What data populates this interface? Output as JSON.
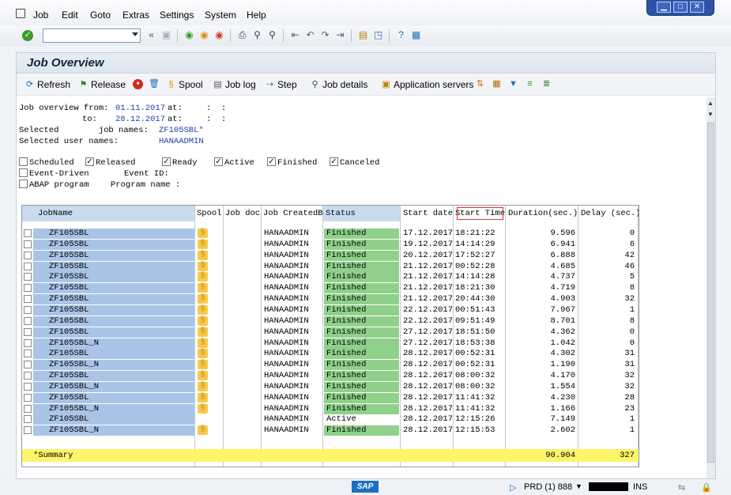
{
  "menu": {
    "items": [
      "Job",
      "Edit",
      "Goto",
      "Extras",
      "Settings",
      "System",
      "Help"
    ]
  },
  "window_controls": [
    "▁",
    "□",
    "✕"
  ],
  "toolbar": {
    "command_field_value": "",
    "icons": [
      "enter-icon",
      "save-icon",
      "back-icon",
      "exit-icon",
      "cancel-icon",
      "print-icon",
      "find-icon",
      "find-next-icon",
      "first-page-icon",
      "previous-page-icon",
      "next-page-icon",
      "last-page-icon",
      "create-session-icon",
      "shortcut-icon",
      "help-icon",
      "customize-layout-icon"
    ]
  },
  "page": {
    "title": "Job Overview"
  },
  "app_toolbar": {
    "refresh": "Refresh",
    "release": "Release",
    "spool": "Spool",
    "job_log": "Job log",
    "step": "Step",
    "job_details": "Job details",
    "application_servers": "Application servers"
  },
  "header": {
    "line1_label": "Job overview from:",
    "from_date": "01.11.2017",
    "at1": "at:",
    "time1": ":  :",
    "to_label": "to:",
    "to_date": "28.12.2017",
    "at2": "at:",
    "time2": ":  :",
    "selected_jobnames_label": "Selected        job names:",
    "selected_jobnames": "ZF105SBL*",
    "selected_users_label": "Selected user names:",
    "selected_users": "HANAADMIN"
  },
  "filters": {
    "scheduled": {
      "label": "Scheduled",
      "checked": false
    },
    "released": {
      "label": "Released",
      "checked": true
    },
    "ready": {
      "label": "Ready",
      "checked": true
    },
    "active": {
      "label": "Active",
      "checked": true
    },
    "finished": {
      "label": "Finished",
      "checked": true
    },
    "canceled": {
      "label": "Canceled",
      "checked": true
    },
    "event_driven": {
      "label": "Event-Driven",
      "checked": false
    },
    "event_id_label": "Event ID:",
    "abap_program": {
      "label": "ABAP program",
      "checked": false
    },
    "program_name_label": "Program name :"
  },
  "table": {
    "columns": [
      "JobName",
      "Spool",
      "Job doc",
      "Job CreatedB",
      "Status",
      "Start date",
      "Start Time",
      "Duration(sec.)",
      "Delay (sec.)"
    ],
    "rows": [
      {
        "job": "ZF105SBL",
        "spool": true,
        "created": "HANAADMIN",
        "status": "Finished",
        "date": "17.12.2017",
        "time": "18:21:22",
        "duration": "9.596",
        "delay": "0"
      },
      {
        "job": "ZF105SBL",
        "spool": true,
        "created": "HANAADMIN",
        "status": "Finished",
        "date": "19.12.2017",
        "time": "14:14:29",
        "duration": "6.941",
        "delay": "6"
      },
      {
        "job": "ZF105SBL",
        "spool": true,
        "created": "HANAADMIN",
        "status": "Finished",
        "date": "20.12.2017",
        "time": "17:52:27",
        "duration": "6.888",
        "delay": "42"
      },
      {
        "job": "ZF105SBL",
        "spool": true,
        "created": "HANAADMIN",
        "status": "Finished",
        "date": "21.12.2017",
        "time": "00:52:28",
        "duration": "4.685",
        "delay": "46"
      },
      {
        "job": "ZF105SBL",
        "spool": true,
        "created": "HANAADMIN",
        "status": "Finished",
        "date": "21.12.2017",
        "time": "14:14:28",
        "duration": "4.737",
        "delay": "5"
      },
      {
        "job": "ZF105SBL",
        "spool": true,
        "created": "HANAADMIN",
        "status": "Finished",
        "date": "21.12.2017",
        "time": "18:21:30",
        "duration": "4.719",
        "delay": "8"
      },
      {
        "job": "ZF105SBL",
        "spool": true,
        "created": "HANAADMIN",
        "status": "Finished",
        "date": "21.12.2017",
        "time": "20:44:30",
        "duration": "4.903",
        "delay": "32"
      },
      {
        "job": "ZF105SBL",
        "spool": true,
        "created": "HANAADMIN",
        "status": "Finished",
        "date": "22.12.2017",
        "time": "00:51:43",
        "duration": "7.967",
        "delay": "1"
      },
      {
        "job": "ZF105SBL",
        "spool": true,
        "created": "HANAADMIN",
        "status": "Finished",
        "date": "22.12.2017",
        "time": "09:51:49",
        "duration": "8.701",
        "delay": "8"
      },
      {
        "job": "ZF105SBL",
        "spool": true,
        "created": "HANAADMIN",
        "status": "Finished",
        "date": "27.12.2017",
        "time": "18:51:50",
        "duration": "4.362",
        "delay": "0"
      },
      {
        "job": "ZF105SBL_N",
        "spool": true,
        "created": "HANAADMIN",
        "status": "Finished",
        "date": "27.12.2017",
        "time": "18:53:38",
        "duration": "1.042",
        "delay": "0"
      },
      {
        "job": "ZF105SBL",
        "spool": true,
        "created": "HANAADMIN",
        "status": "Finished",
        "date": "28.12.2017",
        "time": "00:52:31",
        "duration": "4.302",
        "delay": "31"
      },
      {
        "job": "ZF105SBL_N",
        "spool": true,
        "created": "HANAADMIN",
        "status": "Finished",
        "date": "28.12.2017",
        "time": "00:52:31",
        "duration": "1.190",
        "delay": "31"
      },
      {
        "job": "ZF105SBL",
        "spool": true,
        "created": "HANAADMIN",
        "status": "Finished",
        "date": "28.12.2017",
        "time": "08:00:32",
        "duration": "4.170",
        "delay": "32"
      },
      {
        "job": "ZF105SBL_N",
        "spool": true,
        "created": "HANAADMIN",
        "status": "Finished",
        "date": "28.12.2017",
        "time": "08:00:32",
        "duration": "1.554",
        "delay": "32"
      },
      {
        "job": "ZF105SBL",
        "spool": true,
        "created": "HANAADMIN",
        "status": "Finished",
        "date": "28.12.2017",
        "time": "11:41:32",
        "duration": "4.230",
        "delay": "28"
      },
      {
        "job": "ZF105SBL_N",
        "spool": true,
        "created": "HANAADMIN",
        "status": "Finished",
        "date": "28.12.2017",
        "time": "11:41:32",
        "duration": "1.166",
        "delay": "23"
      },
      {
        "job": "ZF105SBL",
        "spool": false,
        "created": "HANAADMIN",
        "status": "Active",
        "date": "28.12.2017",
        "time": "12:15:26",
        "duration": "7.149",
        "delay": "1"
      },
      {
        "job": "ZF105SBL_N",
        "spool": true,
        "created": "HANAADMIN",
        "status": "Finished",
        "date": "28.12.2017",
        "time": "12:15:53",
        "duration": "2.602",
        "delay": "1"
      }
    ],
    "summary_label": "*Summary",
    "summary_duration": "90.904",
    "summary_delay": "327"
  },
  "statusbar": {
    "logo": "SAP",
    "system": "PRD (1) 888",
    "mode": "INS"
  },
  "colors": {
    "finished": "#8fd18b",
    "jobname_bg": "#a9c4e6",
    "summary": "#fcf56a",
    "title": "#10253f"
  }
}
